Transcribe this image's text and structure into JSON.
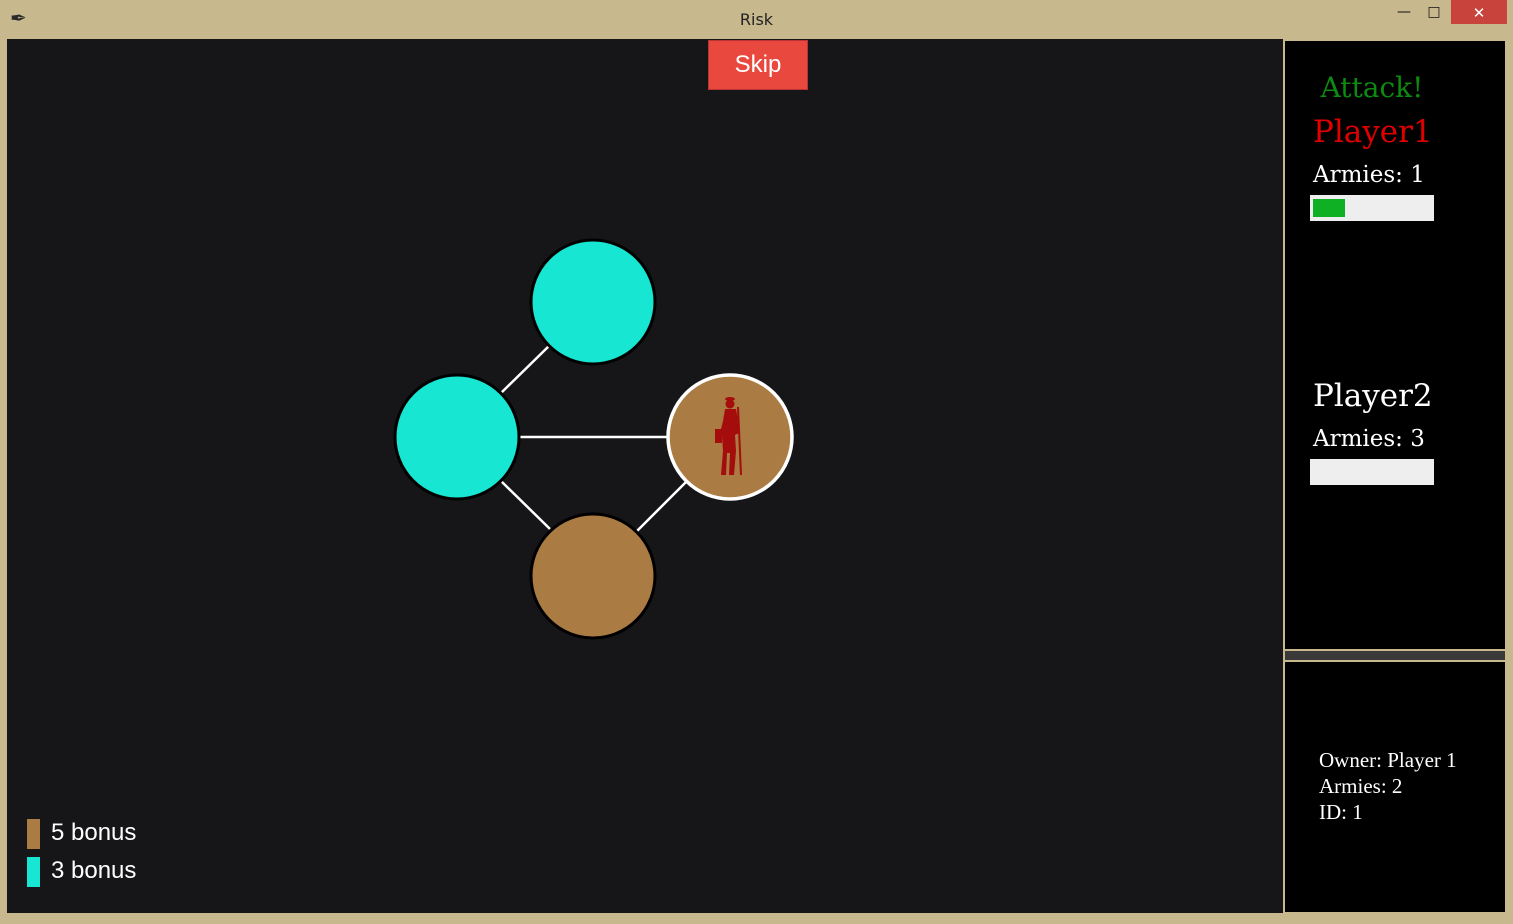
{
  "window": {
    "title": "Risk",
    "minimize_label": "—",
    "maximize_label": "□",
    "close_label": "✕"
  },
  "board": {
    "skip_label": "Skip",
    "background": "#161517",
    "territories": [
      {
        "id": "north",
        "color": "#16e6d2",
        "selected": false,
        "has_army_icon": false
      },
      {
        "id": "west",
        "color": "#16e6d2",
        "selected": false,
        "has_army_icon": false
      },
      {
        "id": "east",
        "color": "#aa7b42",
        "selected": true,
        "has_army_icon": true
      },
      {
        "id": "south",
        "color": "#aa7b42",
        "selected": false,
        "has_army_icon": false
      }
    ],
    "connections": [
      [
        "north",
        "west"
      ],
      [
        "west",
        "east"
      ],
      [
        "west",
        "south"
      ],
      [
        "south",
        "east"
      ]
    ],
    "army_icon": "soldier-icon",
    "army_icon_color": "#a50d0d",
    "legend": [
      {
        "color": "#aa7b42",
        "label": "5 bonus"
      },
      {
        "color": "#16e6d2",
        "label": "3 bonus"
      }
    ]
  },
  "sidebar": {
    "phase": "Attack!",
    "phase_color": "#0d8a10",
    "players": [
      {
        "name": "Player1",
        "name_color": "#e00000",
        "armies": "Armies: 1",
        "progress": 0.27,
        "bar_color": "#0fb024"
      },
      {
        "name": "Player2",
        "name_color": "#ffffff",
        "armies": "Armies: 3",
        "progress": 0
      }
    ]
  },
  "info": {
    "owner": "Owner: Player 1",
    "armies": "Armies: 2",
    "id": "ID: 1"
  }
}
